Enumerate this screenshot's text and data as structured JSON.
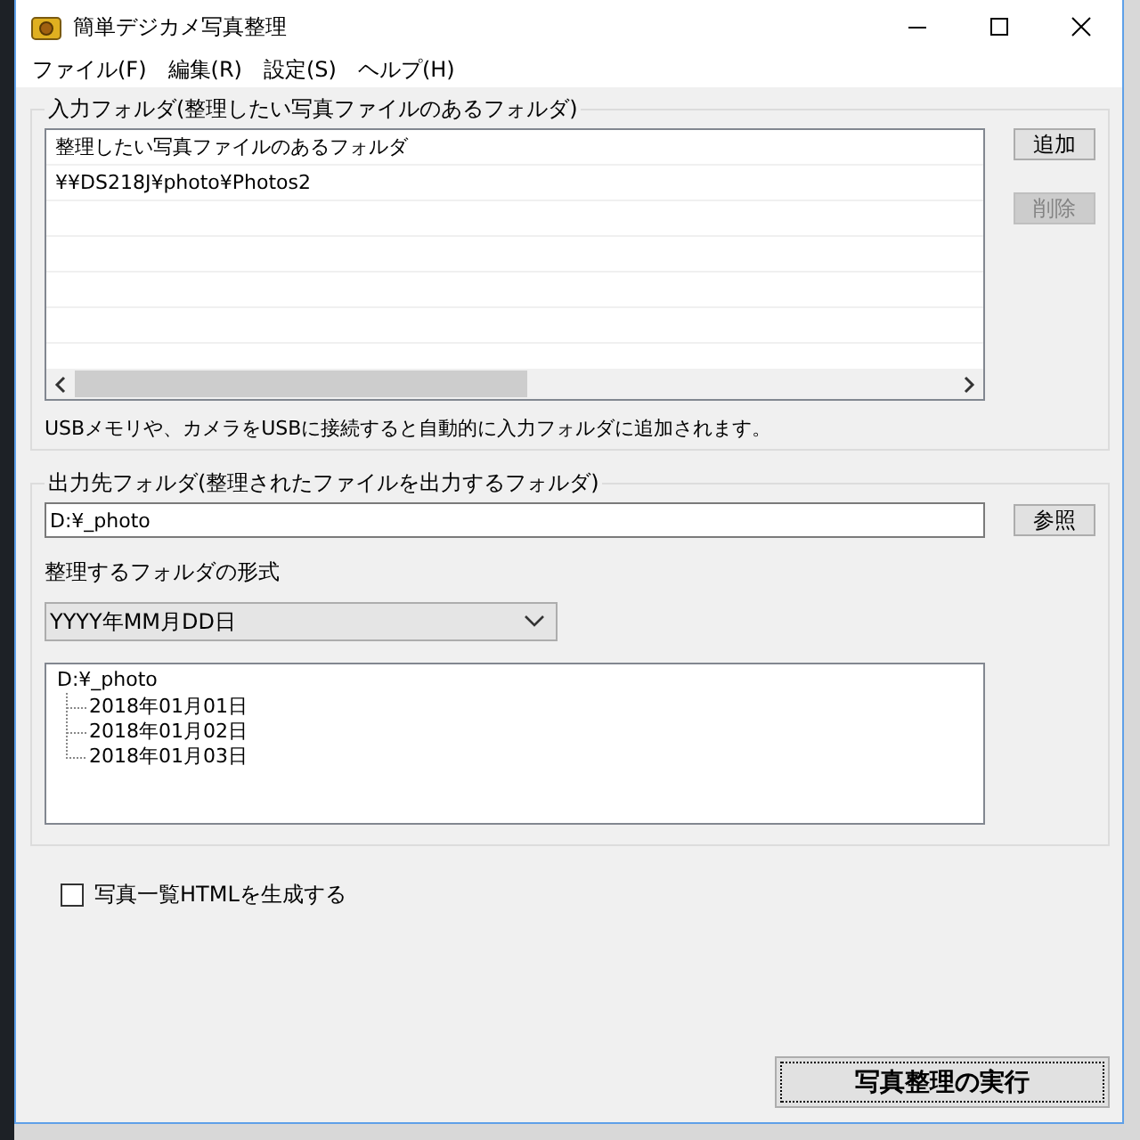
{
  "window": {
    "title": "簡単デジカメ写真整理"
  },
  "menu": [
    {
      "label": "ファイル(F)"
    },
    {
      "label": "編集(R)"
    },
    {
      "label": "設定(S)"
    },
    {
      "label": "ヘルプ(H)"
    }
  ],
  "input_group": {
    "legend": "入力フォルダ(整理したい写真ファイルのあるフォルダ)",
    "list_rows": [
      "整理したい写真ファイルのあるフォルダ",
      "¥¥DS218J¥photo¥Photos2"
    ],
    "buttons": [
      {
        "label": "追加",
        "disabled": false
      },
      {
        "label": "削除",
        "disabled": true
      }
    ],
    "note": "USBメモリや、カメラをUSBに接続すると自動的に入力フォルダに追加されます。"
  },
  "output_group": {
    "legend": "出力先フォルダ(整理されたファイルを出力するフォルダ)",
    "folder": {
      "value": "D:¥_photo"
    },
    "browse_button": "参照",
    "format_label": "整理するフォルダの形式",
    "format_select": {
      "value": "YYYY年MM月DD日"
    },
    "tree": {
      "label": "D:¥_photo",
      "children": [
        {
          "label": "2018年01月01日"
        },
        {
          "label": "2018年01月02日"
        },
        {
          "label": "2018年01月03日"
        }
      ]
    }
  },
  "html_option": {
    "label": "写真一覧HTMLを生成する",
    "checked": false
  },
  "run_button": "写真整理の実行"
}
